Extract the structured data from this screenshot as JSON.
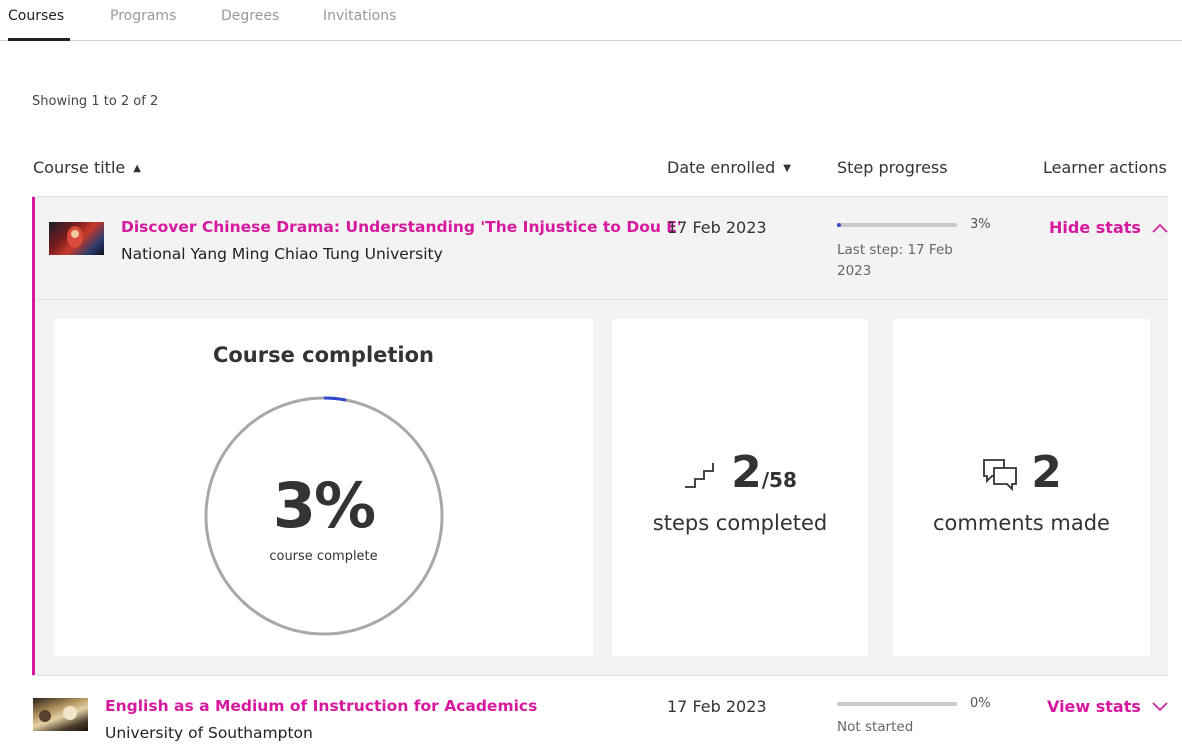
{
  "tabs": [
    {
      "label": "Courses",
      "active": true
    },
    {
      "label": "Programs",
      "active": false
    },
    {
      "label": "Degrees",
      "active": false
    },
    {
      "label": "Invitations",
      "active": false
    }
  ],
  "showing_text": "Showing 1 to 2 of 2",
  "table": {
    "headers": {
      "course_title": "Course title",
      "date_enrolled": "Date enrolled",
      "step_progress": "Step progress",
      "learner_actions": "Learner actions"
    },
    "sort_icons": {
      "course_title": "caret-up-icon",
      "date_enrolled": "caret-down-icon"
    }
  },
  "courses": [
    {
      "title": "Discover Chinese Drama: Understanding 'The Injustice to Dou E'",
      "university": "National Yang Ming Chiao Tung University",
      "date_enrolled": "17 Feb 2023",
      "progress_pct": "3%",
      "progress_value": 0.03,
      "progress_sub": "Last step: 17 Feb 2023",
      "action": "Hide stats",
      "action_icon": "chevron-up-icon",
      "expanded": true
    },
    {
      "title": "English as a Medium of Instruction for Academics",
      "university": "University of Southampton",
      "date_enrolled": "17 Feb 2023",
      "progress_pct": "0%",
      "progress_value": 0.0,
      "progress_sub": "Not started",
      "action": "View stats",
      "action_icon": "chevron-down-icon",
      "expanded": false
    }
  ],
  "stats": {
    "completion_title": "Course completion",
    "completion_pct": "3%",
    "completion_value": 0.03,
    "completion_caption": "course complete",
    "steps_completed": "2",
    "steps_total": "/58",
    "steps_label": "steps completed",
    "steps_icon": "stairs-icon",
    "comments_count": "2",
    "comments_label": "comments made",
    "comments_icon": "comments-icon"
  },
  "colors": {
    "accent": "#d6199e",
    "progress": "#2f49d1",
    "ring_track": "#a8a8a8",
    "row_highlight": "#f3f3f3"
  }
}
